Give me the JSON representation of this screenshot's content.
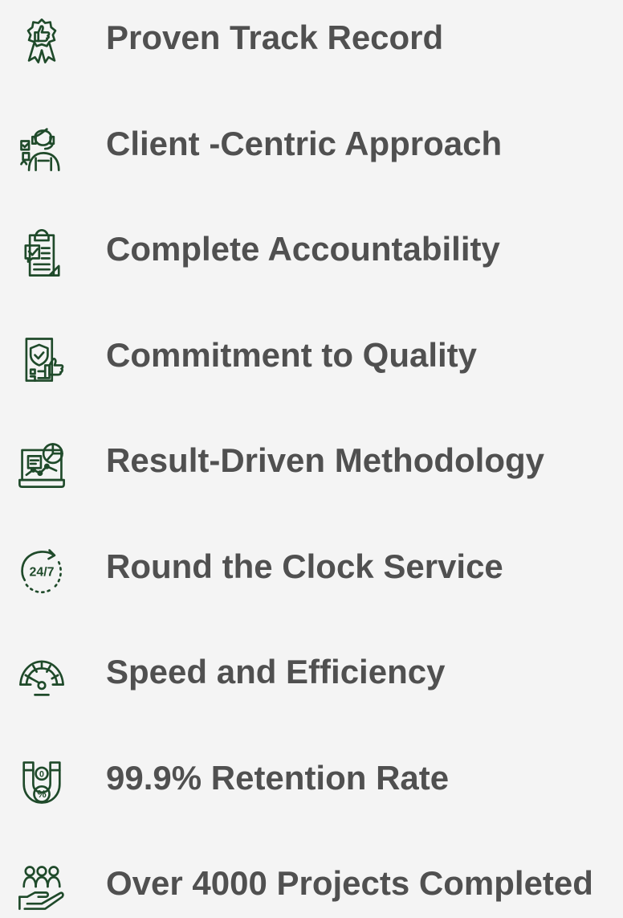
{
  "theme": {
    "background": "#f4f4f4",
    "text": "#505050",
    "icon": "#1f4a2a"
  },
  "features": [
    {
      "label": "Proven Track Record",
      "icon": "thumbs-up-award-icon"
    },
    {
      "label": "Client -Centric Approach",
      "icon": "client-support-icon"
    },
    {
      "label": "Complete Accountability",
      "icon": "clipboard-checklist-icon"
    },
    {
      "label": "Commitment to Quality",
      "icon": "quality-shield-icon"
    },
    {
      "label": "Result-Driven Methodology",
      "icon": "analytics-dashboard-icon"
    },
    {
      "label": "Round the Clock Service",
      "icon": "24-7-service-icon"
    },
    {
      "label": "Speed and Efficiency",
      "icon": "speedometer-icon"
    },
    {
      "label": "99.9% Retention Rate",
      "icon": "magnet-retention-icon"
    },
    {
      "label": "Over 4000 Projects Completed",
      "icon": "team-hand-icon"
    }
  ]
}
